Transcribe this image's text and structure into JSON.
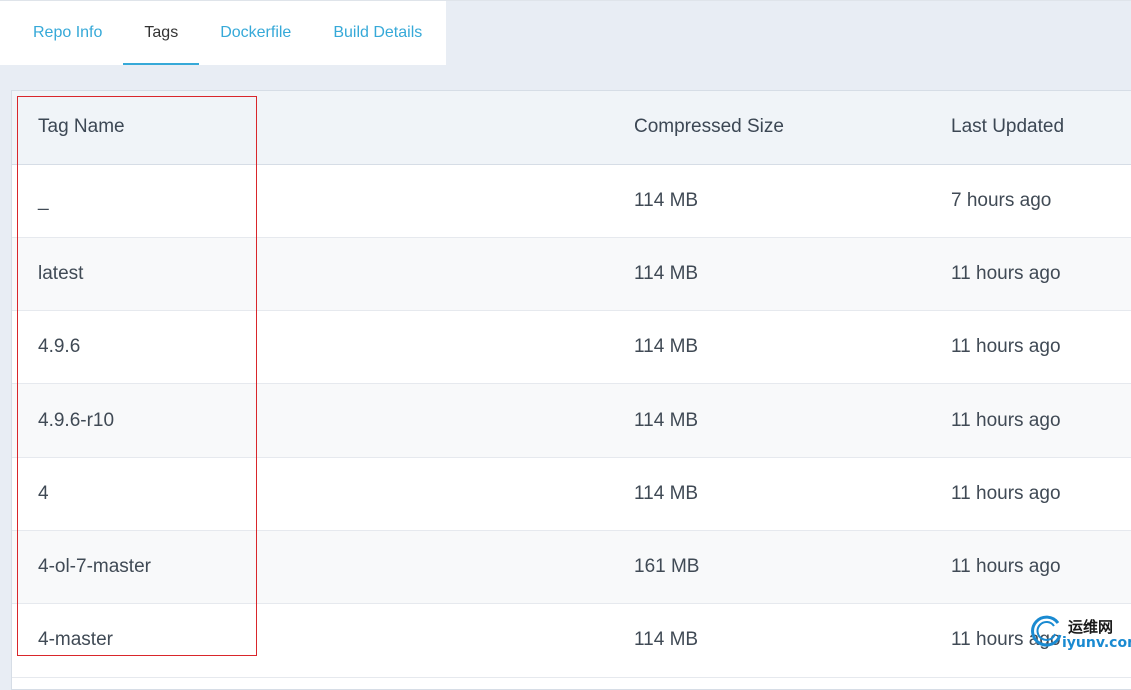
{
  "tabs": [
    {
      "label": "Repo Info",
      "active": false
    },
    {
      "label": "Tags",
      "active": true
    },
    {
      "label": "Dockerfile",
      "active": false
    },
    {
      "label": "Build Details",
      "active": false
    }
  ],
  "table": {
    "headers": {
      "tag_name": "Tag Name",
      "compressed_size": "Compressed Size",
      "last_updated": "Last Updated"
    },
    "rows": [
      {
        "tag": "_",
        "size": "114 MB",
        "updated": "7 hours ago"
      },
      {
        "tag": "latest",
        "size": "114 MB",
        "updated": "11 hours ago"
      },
      {
        "tag": "4.9.6",
        "size": "114 MB",
        "updated": "11 hours ago"
      },
      {
        "tag": "4.9.6-r10",
        "size": "114 MB",
        "updated": "11 hours ago"
      },
      {
        "tag": "4",
        "size": "114 MB",
        "updated": "11 hours ago"
      },
      {
        "tag": "4-ol-7-master",
        "size": "161 MB",
        "updated": "11 hours ago"
      },
      {
        "tag": "4-master",
        "size": "114 MB",
        "updated": "11 hours ago"
      }
    ]
  },
  "watermark": {
    "line1": "运维网",
    "line2": "iyunv.com"
  },
  "colors": {
    "accent": "#36a9d8",
    "highlight": "#d9262b",
    "header_bg": "#f0f4f8",
    "page_bg": "#e8edf4"
  }
}
